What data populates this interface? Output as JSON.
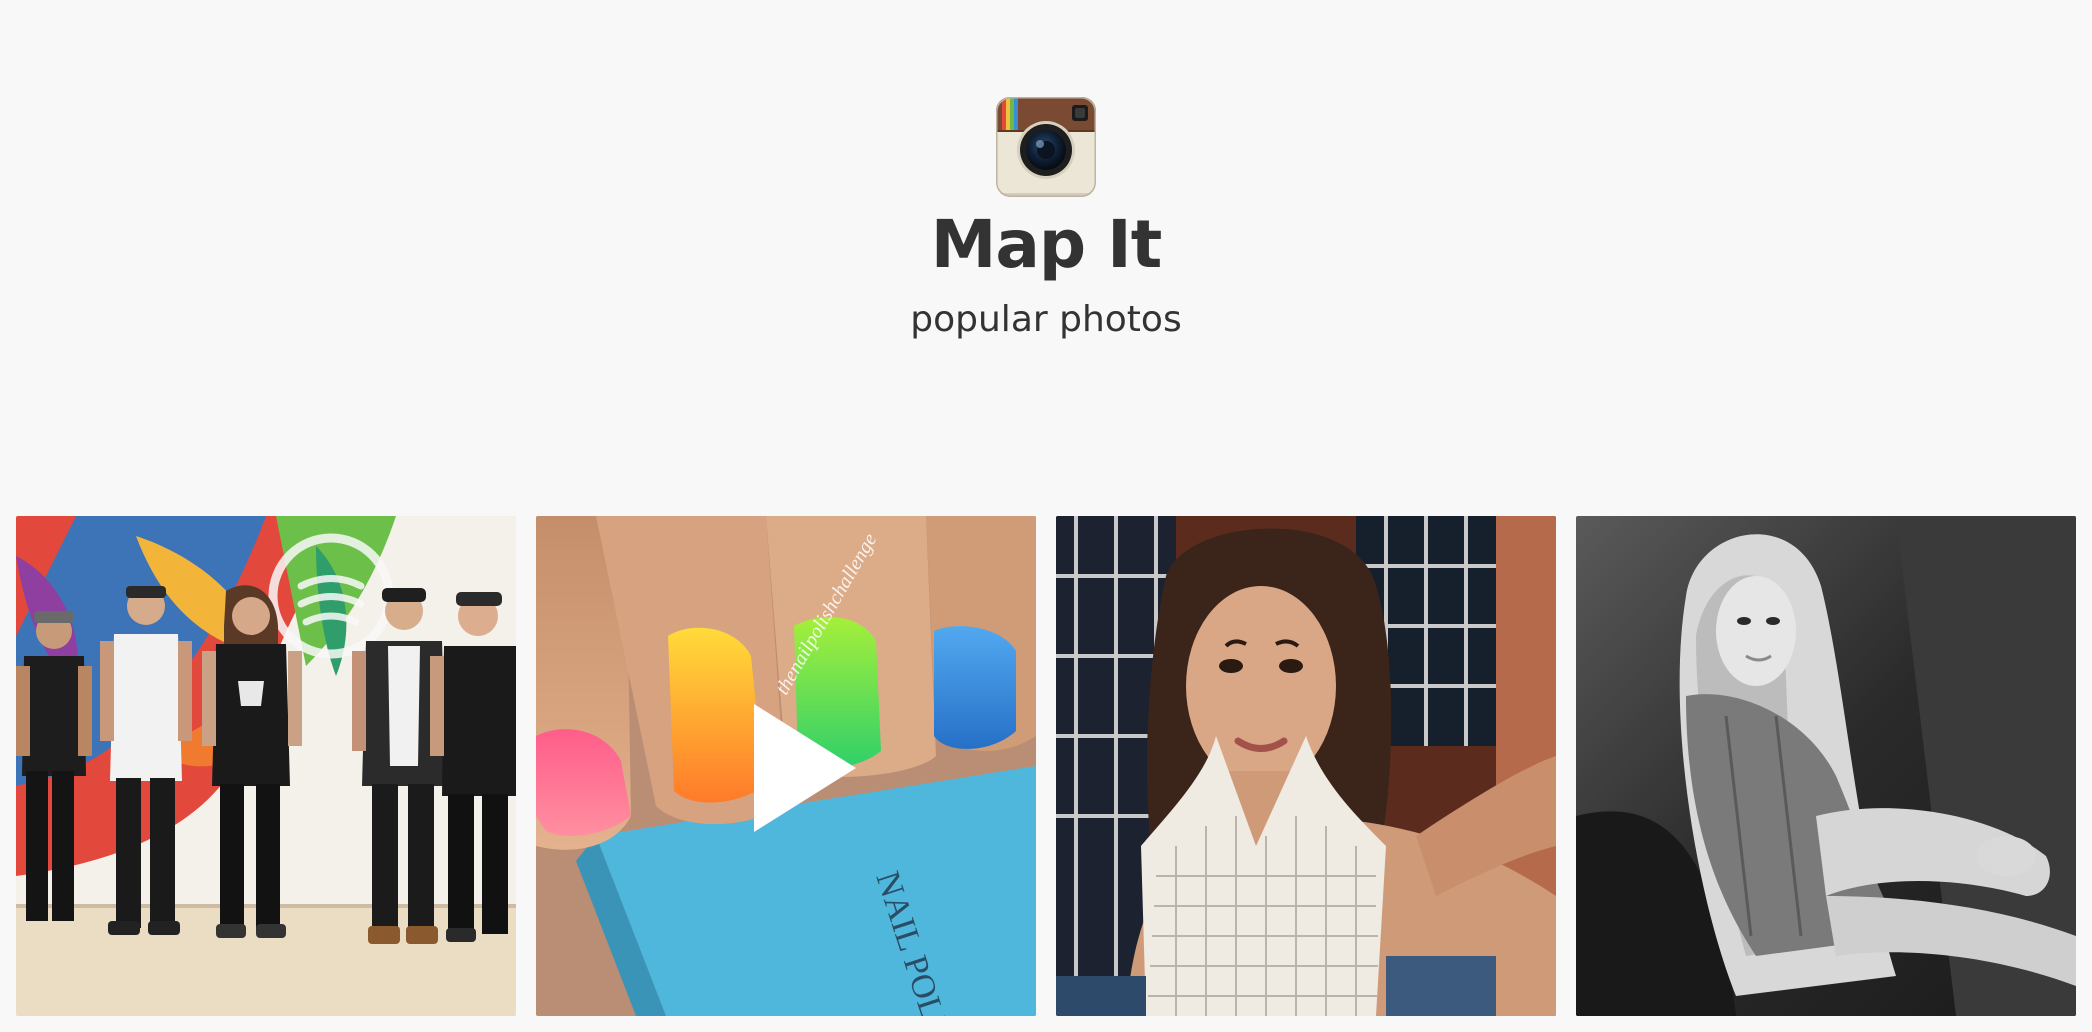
{
  "header": {
    "logo_icon": "instagram-camera-icon",
    "title": "Map It",
    "subtitle": "popular photos"
  },
  "photos": [
    {
      "kind": "image",
      "subject": "band-group-photo",
      "icon": "photo-icon"
    },
    {
      "kind": "video",
      "subject": "rainbow-nail-polish",
      "icon": "play-icon",
      "overlay_text": "thenailpolishchallenge",
      "bottle_text": "NAIL POLISH"
    },
    {
      "kind": "image",
      "subject": "selfie-portrait",
      "icon": "photo-icon"
    },
    {
      "kind": "image",
      "subject": "black-and-white-portrait",
      "icon": "photo-icon"
    }
  ],
  "colors": {
    "background": "#f8f8f8",
    "text": "#333333",
    "play_overlay": "#ffffff"
  }
}
